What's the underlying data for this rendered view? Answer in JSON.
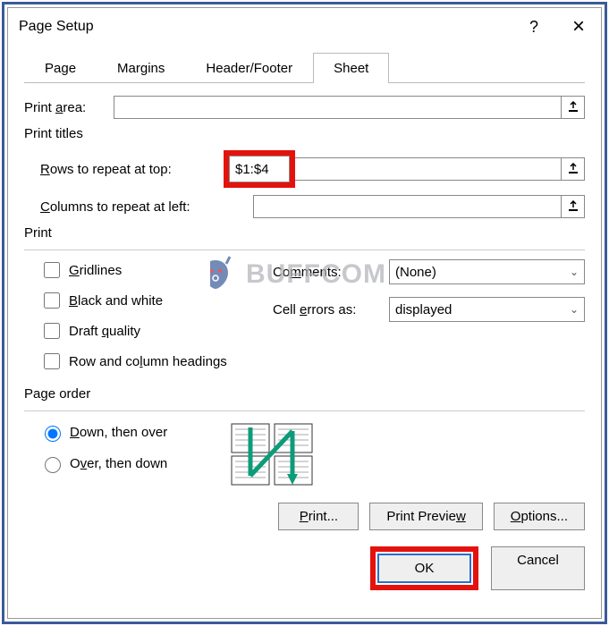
{
  "titlebar": {
    "title": "Page Setup",
    "help": "?",
    "close": "×"
  },
  "tabs": {
    "page": "Page",
    "margins": "Margins",
    "headerfooter": "Header/Footer",
    "sheet": "Sheet"
  },
  "printarea": {
    "label_pre": "Print ",
    "label_u": "a",
    "label_post": "rea:",
    "value": ""
  },
  "printtitles": {
    "label": "Print titles",
    "rows_u": "R",
    "rows_post": "ows to repeat at top:",
    "rows_value": "$1:$4",
    "cols_u": "C",
    "cols_post": "olumns to repeat at left:",
    "cols_value": ""
  },
  "print": {
    "label": "Print",
    "gridlines_u": "G",
    "gridlines_post": "ridlines",
    "bw_u": "B",
    "bw_post": "lack and white",
    "draft_pre": "Draft ",
    "draft_u": "q",
    "draft_post": "uality",
    "rowcol_pre": "Row and co",
    "rowcol_u": "l",
    "rowcol_post": "umn headings",
    "comments_pre": "Co",
    "comments_u": "m",
    "comments_post": "ments:",
    "comments_value": "(None)",
    "errors_pre": "Cell ",
    "errors_u": "e",
    "errors_post": "rrors as:",
    "errors_value": "displayed"
  },
  "pageorder": {
    "label": "Page order",
    "down_u": "D",
    "down_post": "own, then over",
    "over_pre": "O",
    "over_u": "v",
    "over_post": "er, then down"
  },
  "buttons": {
    "print_u": "P",
    "print_post": "rint...",
    "preview_pre": "Print Previe",
    "preview_u": "w",
    "options_u": "O",
    "options_post": "ptions...",
    "ok": "OK",
    "cancel": "Cancel"
  },
  "watermark": "BUFFCOM"
}
